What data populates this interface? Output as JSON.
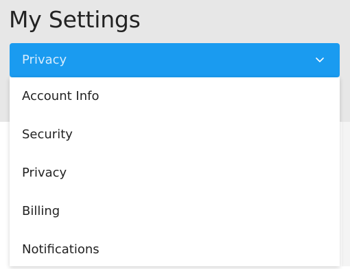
{
  "header": {
    "title": "My Settings"
  },
  "select": {
    "current_value": "Privacy",
    "icon": "chevron-down-icon"
  },
  "dropdown": {
    "items": [
      {
        "label": "Account Info"
      },
      {
        "label": "Security"
      },
      {
        "label": "Privacy"
      },
      {
        "label": "Billing"
      },
      {
        "label": "Notifications"
      }
    ]
  },
  "colors": {
    "select_background": "#1a9bf0",
    "select_text": "#d6ecfd",
    "header_background": "#e7e7e7",
    "menu_background": "#ffffff",
    "text": "#222222"
  }
}
